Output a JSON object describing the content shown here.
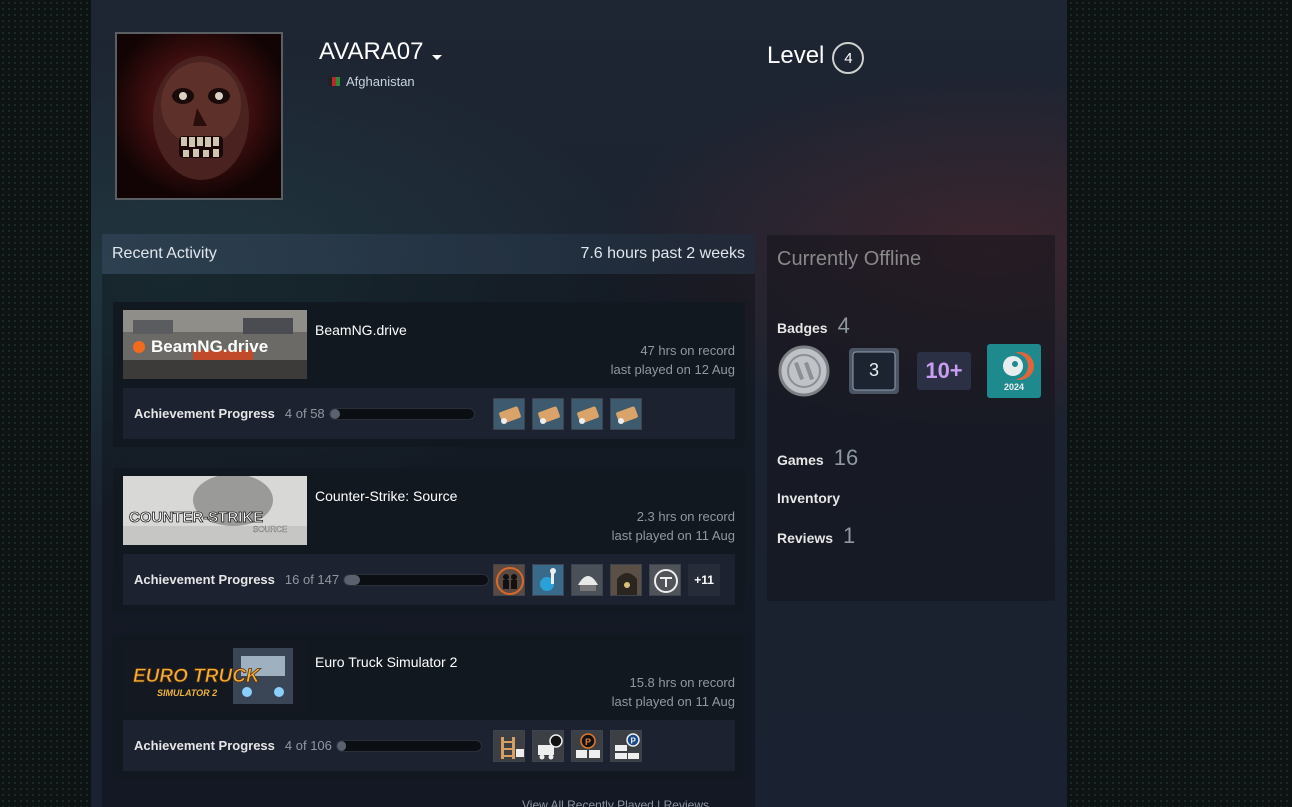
{
  "profile": {
    "persona_name": "AVARA07",
    "country": "Afghanistan",
    "level_label": "Level",
    "level": "4"
  },
  "activity": {
    "title": "Recent Activity",
    "summary": "7.6 hours past 2 weeks",
    "ach_label": "Achievement Progress",
    "games": [
      {
        "name": "BeamNG.drive",
        "capsule_text": "BeamNG.drive",
        "hours": "47 hrs on record",
        "last_played": "last played on 12 Aug",
        "progress_text": "4 of 58",
        "progress_fraction": 0.069,
        "icons": [
          "crash-car-icon",
          "crash-car-icon",
          "crash-car-icon",
          "crash-car-icon"
        ],
        "more": ""
      },
      {
        "name": "Counter-Strike: Source",
        "capsule_text": "COUNTER-STRIKE",
        "capsule_sub": "SOURCE",
        "hours": "2.3 hrs on record",
        "last_played": "last played on 11 Aug",
        "progress_text": "16 of 147",
        "progress_fraction": 0.109,
        "icons": [
          "soldiers-icon",
          "bomb-defuse-icon",
          "helmet-icon",
          "tunnel-icon",
          "target-icon"
        ],
        "more": "+11"
      },
      {
        "name": "Euro Truck Simulator 2",
        "capsule_text": "EURO TRUCK",
        "capsule_sub": "SIMULATOR 2",
        "hours": "15.8 hrs on record",
        "last_played": "last played on 11 Aug",
        "progress_text": "4 of 106",
        "progress_fraction": 0.038,
        "icons": [
          "truck-ladder-icon",
          "truck-fuel-icon",
          "truck-parking-icon",
          "truck-parking-icon"
        ],
        "more": ""
      }
    ],
    "footer": "View All Recently Played | Reviews"
  },
  "sidebar": {
    "status": "Currently Offline",
    "badges_label": "Badges",
    "badges_count": "4",
    "badge_icons": [
      "coin-badge-icon",
      "years-badge-icon",
      "games-badge-icon",
      "steam-2024-badge-icon"
    ],
    "badge_years": "3",
    "badge_games": "10+",
    "badge_year_text": "2024",
    "games_label": "Games",
    "games_count": "16",
    "inventory_label": "Inventory",
    "reviews_label": "Reviews",
    "reviews_count": "1"
  }
}
